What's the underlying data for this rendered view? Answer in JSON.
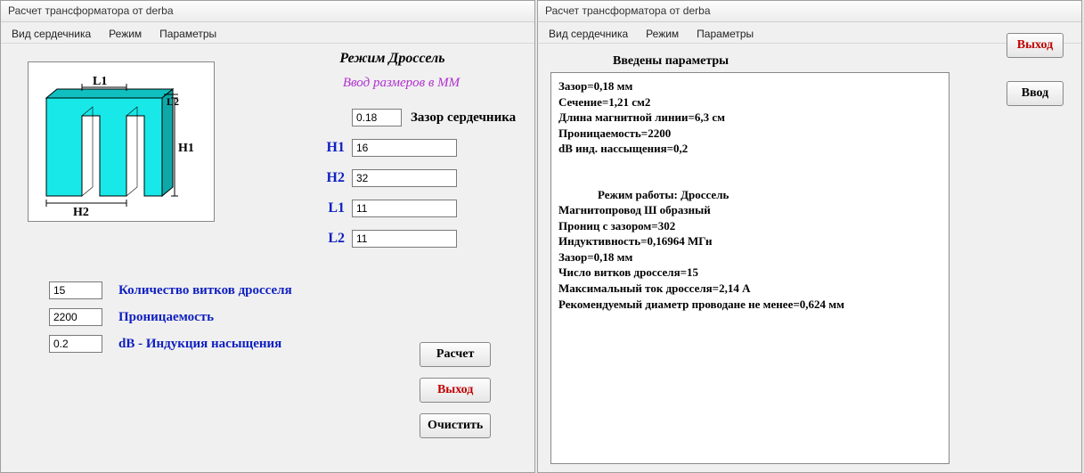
{
  "left": {
    "title": "Расчет трансформатора от derba",
    "menu": {
      "core_type": "Вид сердечника",
      "mode": "Режим",
      "parameters": "Параметры"
    },
    "mode_title": "Режим Дроссель",
    "subtitle": "Ввод размеров в ММ",
    "dims": {
      "gap_label": "Зазор сердечника",
      "gap": "0.18",
      "h1_label": "H1",
      "h1": "16",
      "h2_label": "H2",
      "h2": "32",
      "l1_label": "L1",
      "l1": "11",
      "l2_label": "L2",
      "l2": "11"
    },
    "params": {
      "turns": "15",
      "turns_label": "Количество витков дросселя",
      "perm": "2200",
      "perm_label": "Проницаемость",
      "db": "0.2",
      "db_label": "dB - Индукция насыщения"
    },
    "buttons": {
      "calc": "Расчет",
      "exit": "Выход",
      "clear": "Очистить"
    },
    "diagram_labels": {
      "L1": "L1",
      "L2": "L2",
      "H1": "H1",
      "H2": "H2"
    }
  },
  "right": {
    "title": "Расчет трансформатора от derba",
    "menu": {
      "core_type": "Вид сердечника",
      "mode": "Режим",
      "parameters": "Параметры"
    },
    "params_title": "Введены параметры",
    "results": {
      "l1": "Зазор=0,18 мм",
      "l2": "Сечение=1,21 см2",
      "l3": "Длина магнитной линии=6,3 см",
      "l4": "Проницаемость=2200",
      "l5": "dB инд. нассыщения=0,2",
      "mode": "Режим работы: Дроссель",
      "l6": "Магнитопровод Ш образный",
      "l7": "Прониц с зазором=302",
      "l8": "Индуктивность=0,16964 МГн",
      "l9": "Зазор=0,18 мм",
      "l10": "Число витков дросселя=15",
      "l11": "Максимальный ток дросселя=2,14 А",
      "l12": "Рекомендуемый диаметр проводане не менее=0,624 мм"
    },
    "buttons": {
      "enter": "Ввод",
      "exit": "Выход"
    }
  }
}
